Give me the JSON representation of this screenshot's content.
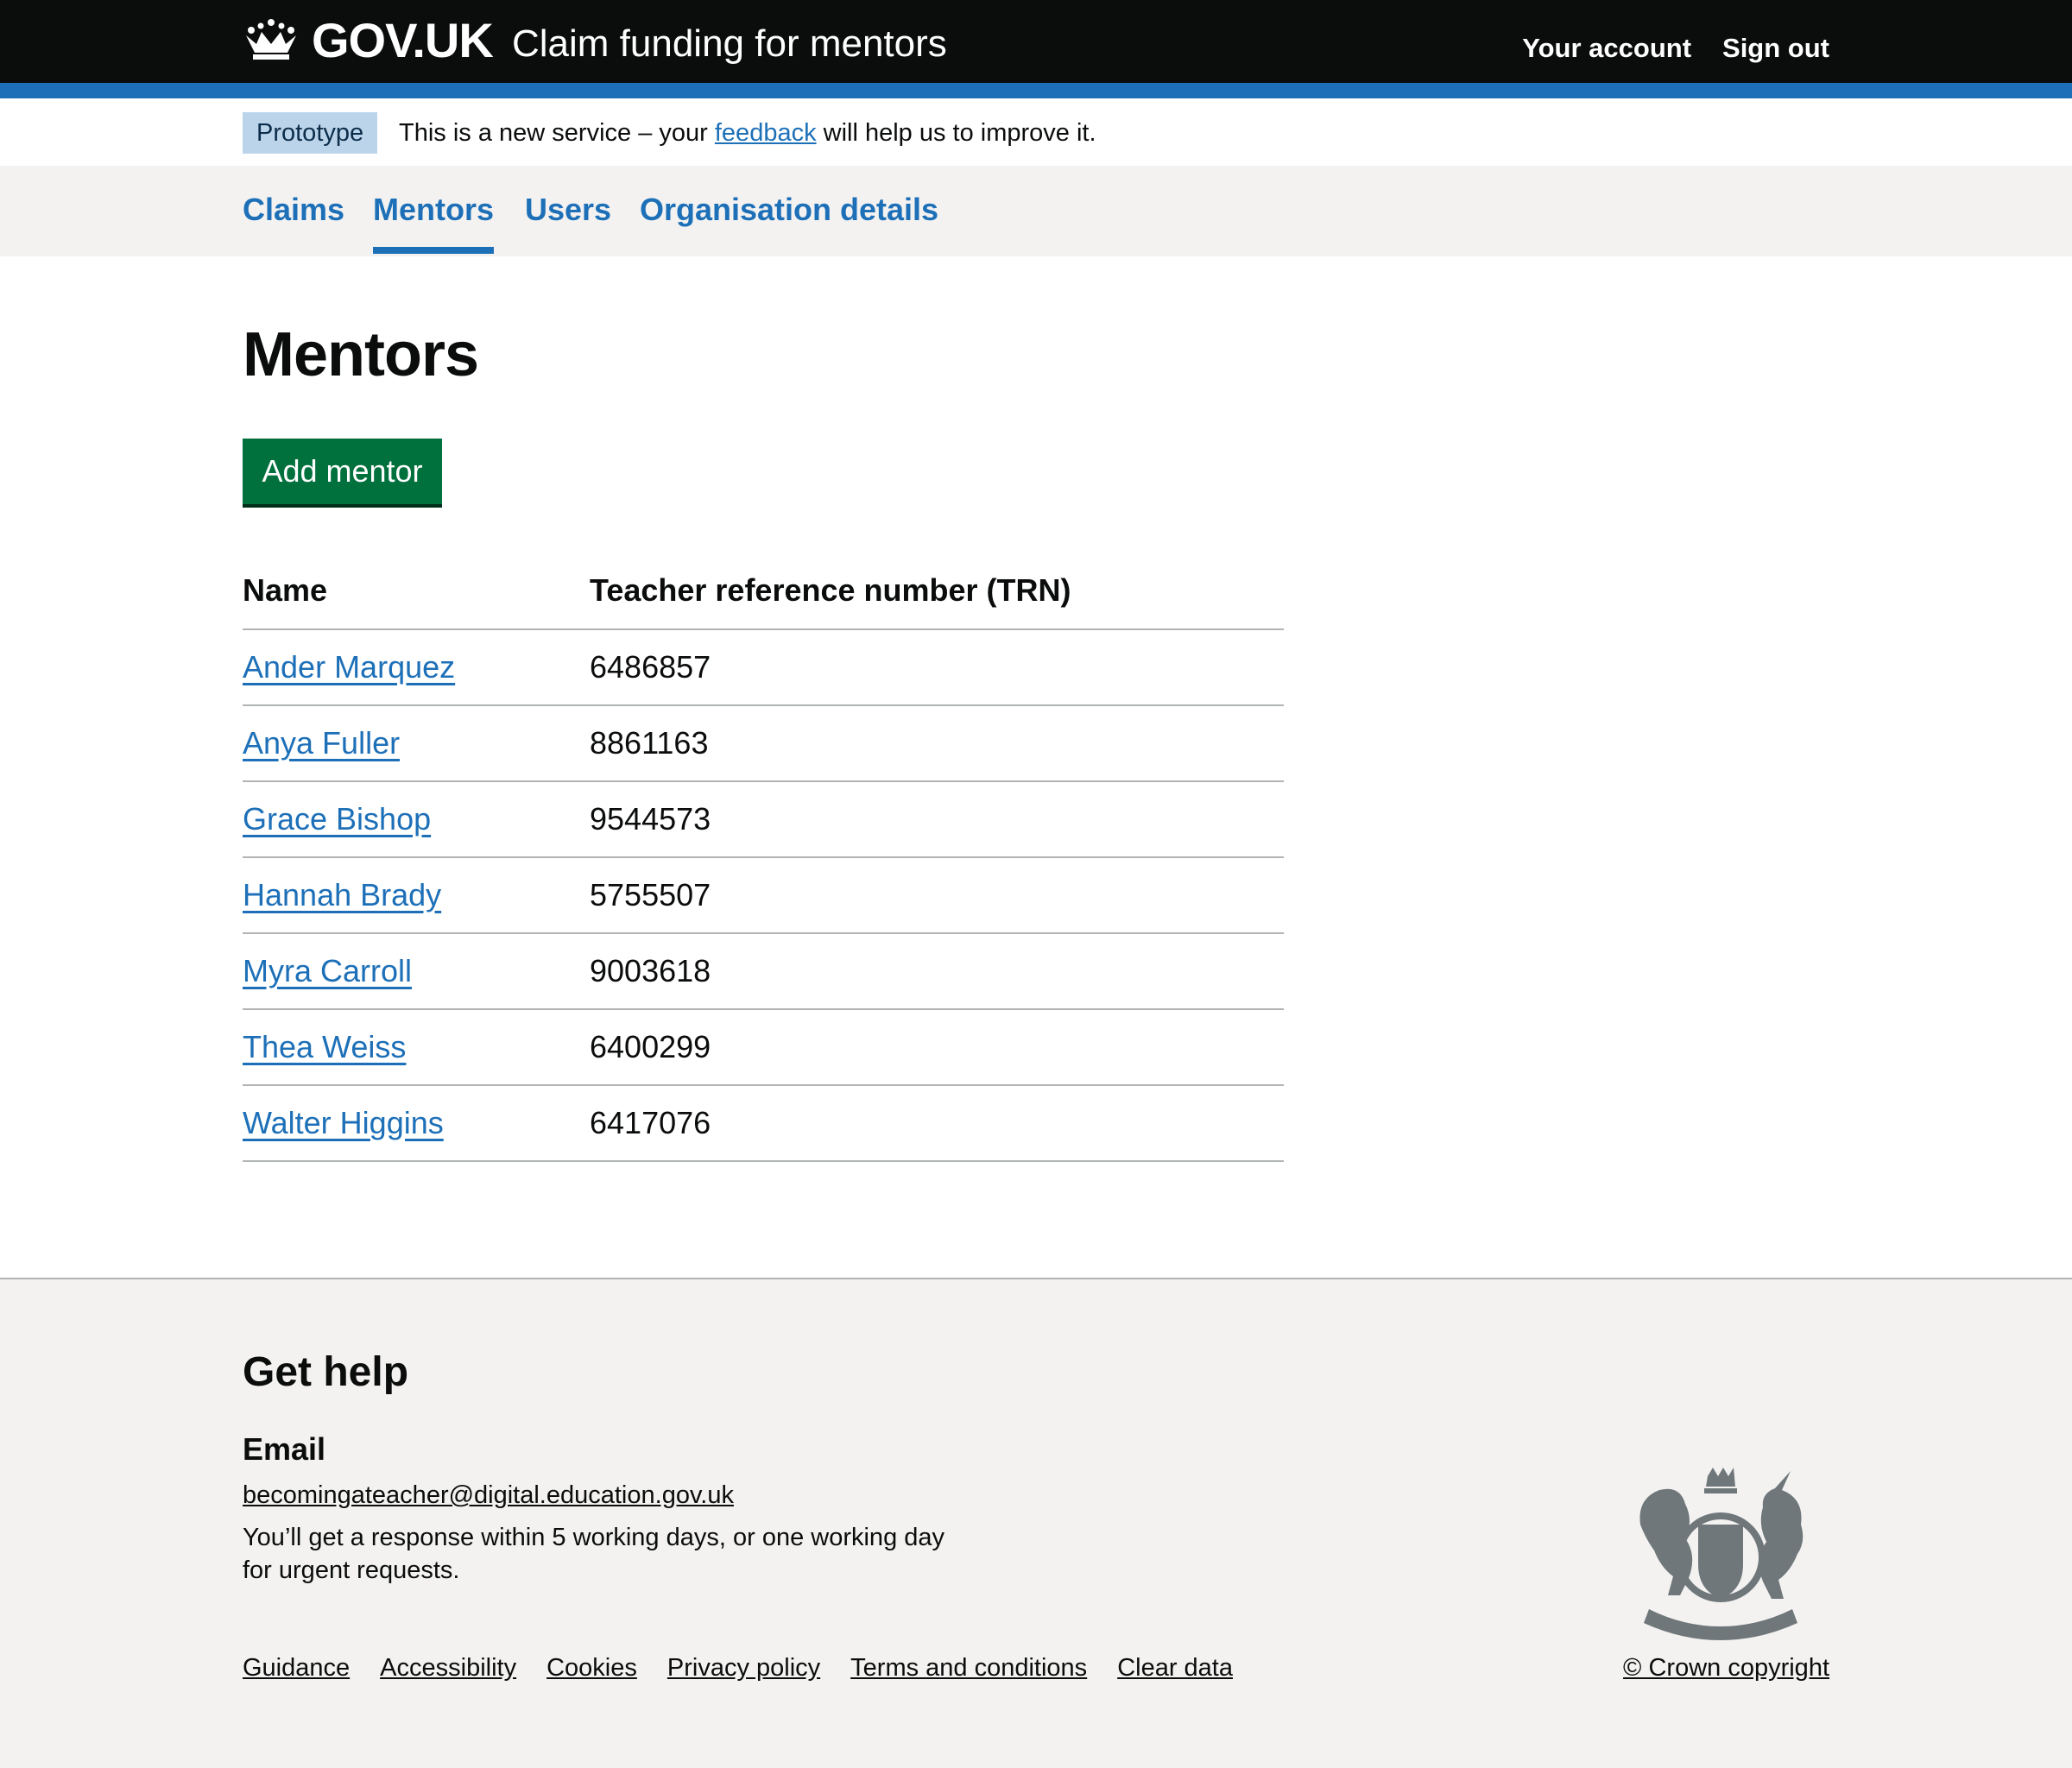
{
  "header": {
    "logo_text": "GOV.UK",
    "service_name": "Claim funding for mentors",
    "nav": {
      "account": "Your account",
      "sign_out": "Sign out"
    }
  },
  "phase_banner": {
    "tag": "Prototype",
    "text_before": "This is a new service – your",
    "link": "feedback",
    "text_after": "will help us to improve it."
  },
  "service_nav": {
    "items": [
      {
        "label": "Claims"
      },
      {
        "label": "Mentors",
        "active": true
      },
      {
        "label": "Users"
      },
      {
        "label": "Organisation details"
      }
    ]
  },
  "main": {
    "title": "Mentors",
    "add_button": "Add mentor",
    "table": {
      "headers": [
        "Name",
        "Teacher reference number (TRN)"
      ],
      "rows": [
        {
          "name": "Ander Marquez",
          "trn": "6486857"
        },
        {
          "name": "Anya Fuller",
          "trn": "8861163"
        },
        {
          "name": "Grace Bishop",
          "trn": "9544573"
        },
        {
          "name": "Hannah Brady",
          "trn": "5755507"
        },
        {
          "name": "Myra Carroll",
          "trn": "9003618"
        },
        {
          "name": "Thea Weiss",
          "trn": "6400299"
        },
        {
          "name": "Walter Higgins",
          "trn": "6417076"
        }
      ]
    }
  },
  "footer": {
    "help_title": "Get help",
    "email_heading": "Email",
    "email": "becomingateacher@digital.education.gov.uk",
    "response_text": "You’ll get a response within 5 working days, or one working day for urgent requests.",
    "links": [
      "Guidance",
      "Accessibility",
      "Cookies",
      "Privacy policy",
      "Terms and conditions",
      "Clear data"
    ],
    "copyright": "© Crown copyright"
  },
  "colors": {
    "header_bg": "#0b0c0c",
    "brand_blue": "#1d70b8",
    "button_green": "#00703c",
    "footer_bg": "#f3f2f1",
    "phase_tag_bg": "#bbd4ea"
  },
  "icons": {
    "logo": "crown-icon",
    "crest": "royal-coat-of-arms-icon"
  }
}
